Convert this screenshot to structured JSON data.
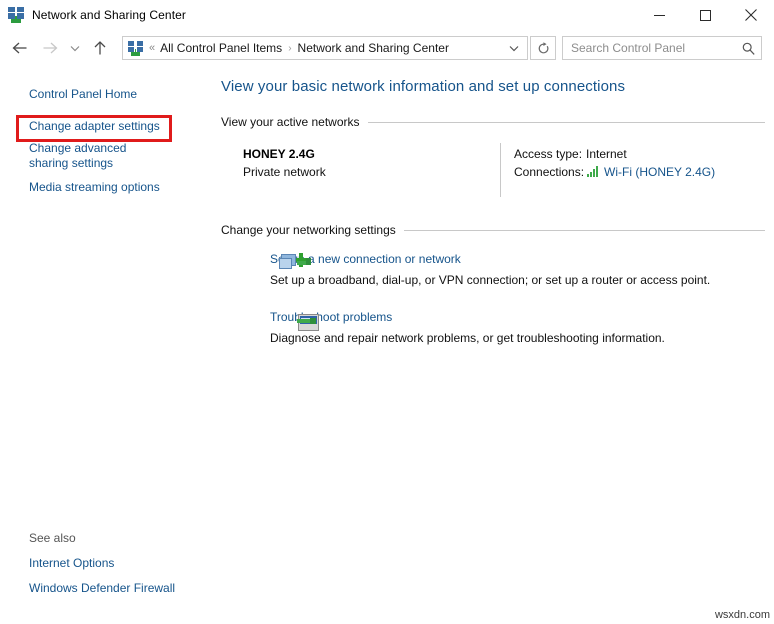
{
  "window": {
    "title": "Network and Sharing Center",
    "icon": "network-icon",
    "minimize_label": "Minimize",
    "maximize_label": "Maximize",
    "close_label": "Close"
  },
  "nav": {
    "back_label": "Back",
    "forward_label": "Forward",
    "history_label": "Recent locations",
    "up_label": "Up",
    "refresh_label": "Refresh",
    "address_overflow": "«",
    "breadcrumbs": [
      {
        "label": "All Control Panel Items"
      },
      {
        "label": "Network and Sharing Center"
      }
    ],
    "breadcrumb_separator": "›",
    "dropdown_label": "Previous locations"
  },
  "search": {
    "placeholder": "Search Control Panel",
    "value": ""
  },
  "sidebar": {
    "items": [
      {
        "label": "Control Panel Home",
        "name": "control-panel-home"
      },
      {
        "label": "Change adapter settings",
        "name": "change-adapter-settings",
        "highlighted": true
      },
      {
        "label": "Change advanced sharing settings",
        "name": "change-advanced-sharing-settings"
      },
      {
        "label": "Media streaming options",
        "name": "media-streaming-options"
      }
    ],
    "see_also": {
      "title": "See also",
      "links": [
        {
          "label": "Internet Options"
        },
        {
          "label": "Windows Defender Firewall"
        }
      ]
    }
  },
  "main": {
    "heading": "View your basic network information and set up connections",
    "active_networks_section": "View your active networks",
    "active_network": {
      "name": "HONEY 2.4G",
      "type": "Private network",
      "access_type_label": "Access type:",
      "access_type_value": "Internet",
      "connections_label": "Connections:",
      "connection_link": "Wi-Fi (HONEY 2.4G)",
      "connection_icon": "wifi-signal-bars-icon"
    },
    "settings_section": "Change your networking settings",
    "actions": [
      {
        "title": "Set up a new connection or network",
        "description": "Set up a broadband, dial-up, or VPN connection; or set up a router or access point.",
        "icon": "new-connection-icon"
      },
      {
        "title": "Troubleshoot problems",
        "description": "Diagnose and repair network problems, or get troubleshooting information.",
        "icon": "troubleshoot-icon"
      }
    ]
  },
  "annotation": {
    "color": "#e01b1b",
    "target": "Change adapter settings"
  },
  "watermark": "wsxdn.com"
}
